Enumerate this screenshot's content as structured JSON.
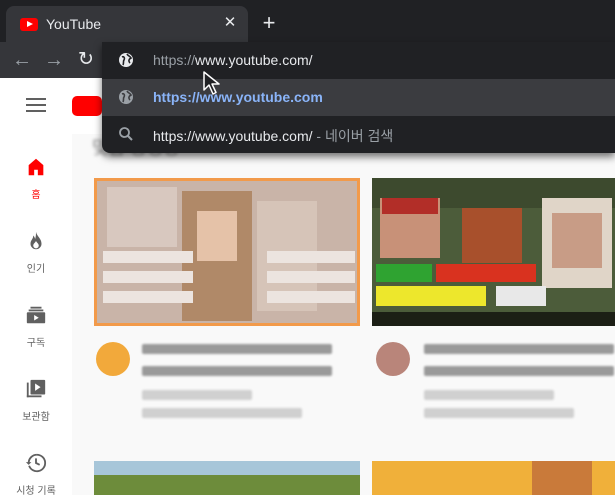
{
  "browser": {
    "tab": {
      "title": "YouTube",
      "close_glyph": "✕"
    },
    "new_tab_glyph": "+",
    "nav": {
      "back_glyph": "←",
      "forward_glyph": "→",
      "reload_glyph": "↻"
    },
    "omnibox": {
      "input": {
        "scheme": "https://",
        "host": "www.youtube.com/"
      },
      "suggestions": [
        {
          "text": "https://www.youtube.com",
          "icon": "globe-icon"
        },
        {
          "text": "https://www.youtube.com/",
          "sub": "- 네이버 검색",
          "icon": "search-icon"
        }
      ]
    }
  },
  "sidebar": {
    "items": [
      {
        "label": "홈",
        "icon": "home-icon",
        "active": true
      },
      {
        "label": "인기",
        "icon": "fire-icon",
        "active": false
      },
      {
        "label": "구독",
        "icon": "subscriptions-icon",
        "active": false
      },
      {
        "label": "보관함",
        "icon": "library-icon",
        "active": false
      },
      {
        "label": "시청 기록",
        "icon": "history-icon",
        "active": false
      }
    ]
  },
  "feed": {
    "section_heading": "맞춤 동영상"
  },
  "colors": {
    "brand_red": "#ff0000",
    "link_blue": "#8ab4f8",
    "chrome_dark": "#202124"
  }
}
